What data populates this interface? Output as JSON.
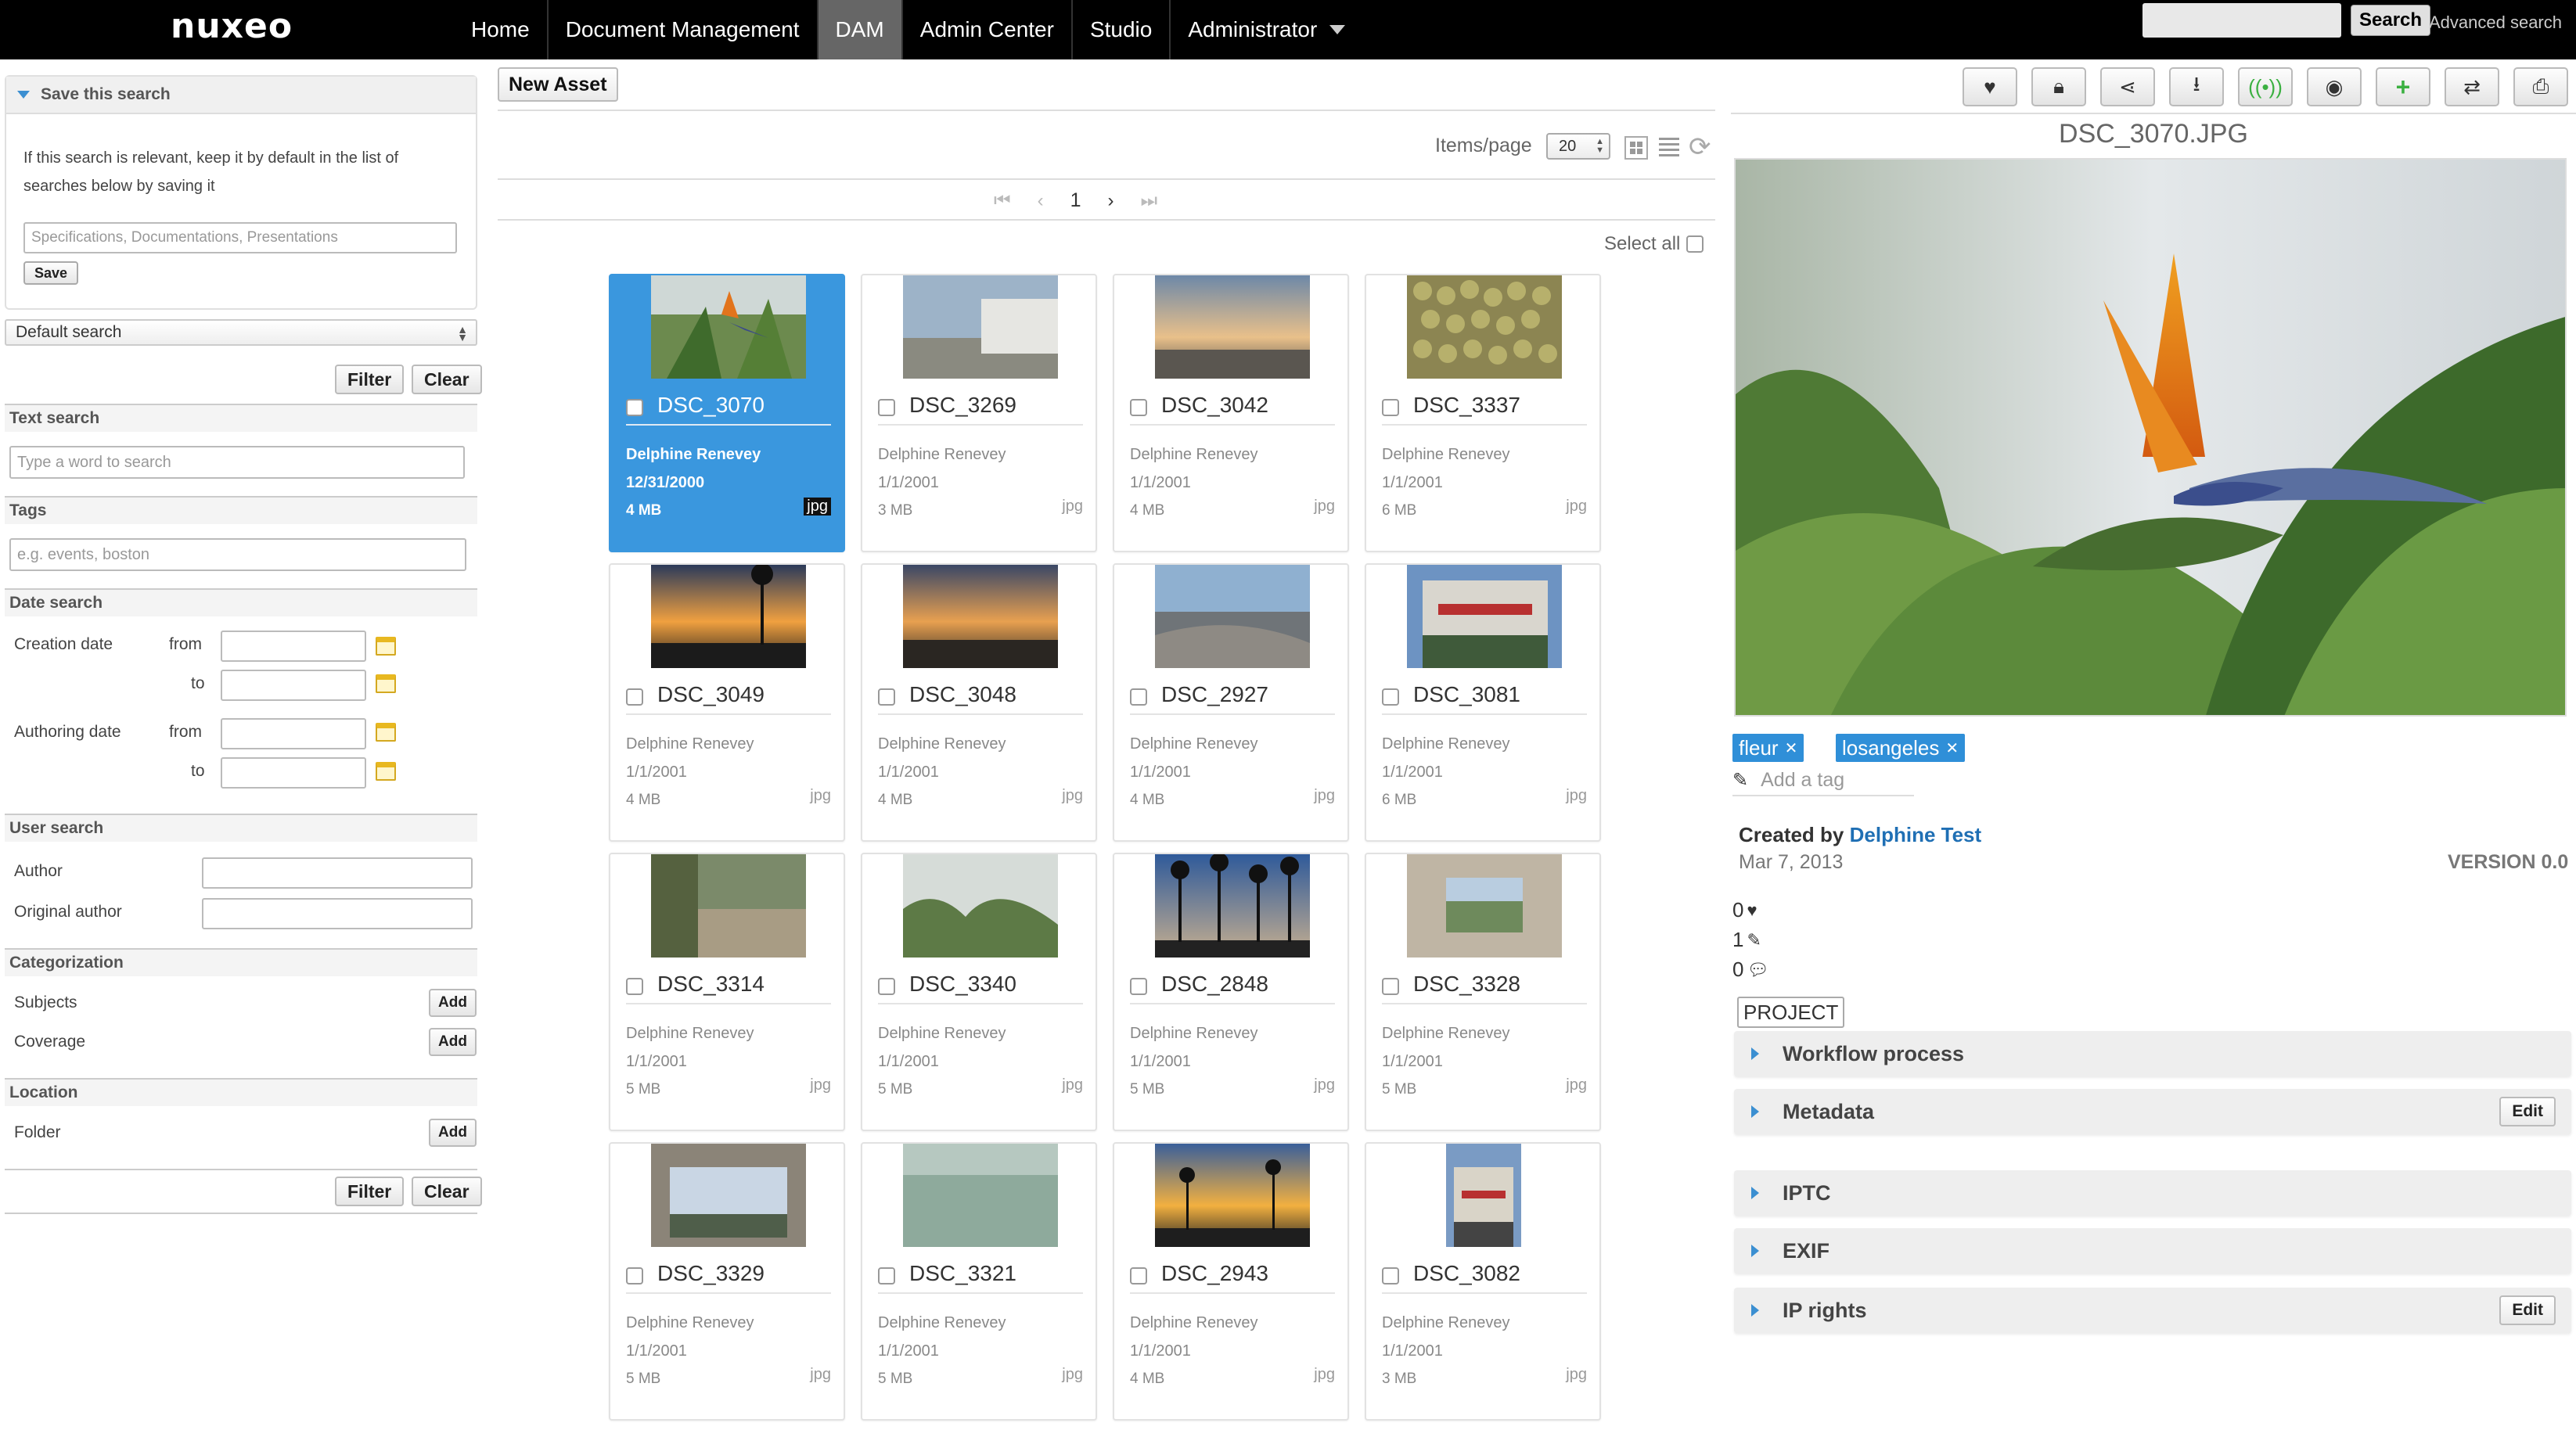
{
  "topbar": {
    "logo": "nuxeo",
    "nav": [
      {
        "label": "Home",
        "active": false
      },
      {
        "label": "Document Management",
        "active": false
      },
      {
        "label": "DAM",
        "active": true
      },
      {
        "label": "Admin Center",
        "active": false
      },
      {
        "label": "Studio",
        "active": false
      },
      {
        "label": "Administrator",
        "active": false
      }
    ],
    "search_button": "Search",
    "advanced_search": "Advanced search"
  },
  "sidebar": {
    "save_search": {
      "header": "Save this search",
      "description": "If this search is relevant, keep it by default in the list of searches below by saving it",
      "placeholder": "Specifications, Documentations, Presentations",
      "save_label": "Save"
    },
    "search_select": "Default search",
    "filter_label": "Filter",
    "clear_label": "Clear",
    "text_search": {
      "header": "Text search",
      "placeholder": "Type a word to search"
    },
    "tags": {
      "header": "Tags",
      "placeholder": "e.g. events, boston"
    },
    "date_search": {
      "header": "Date search",
      "creation_date": "Creation date",
      "authoring_date": "Authoring date",
      "from": "from",
      "to": "to"
    },
    "user_search": {
      "header": "User search",
      "author": "Author",
      "original_author": "Original author"
    },
    "categorization": {
      "header": "Categorization",
      "subjects": "Subjects",
      "coverage": "Coverage",
      "add_label": "Add"
    },
    "location": {
      "header": "Location",
      "folder": "Folder",
      "add_label": "Add"
    }
  },
  "center": {
    "new_asset": "New Asset",
    "items_per_page_label": "Items/page",
    "items_per_page": "20",
    "current_page": "1",
    "select_all": "Select all",
    "assets": [
      {
        "name": "DSC_3070",
        "author": "Delphine Renevey",
        "date": "12/31/2000",
        "size": "4 MB",
        "type": "jpg",
        "selected": true
      },
      {
        "name": "DSC_3269",
        "author": "Delphine Renevey",
        "date": "1/1/2001",
        "size": "3 MB",
        "type": "jpg",
        "selected": false
      },
      {
        "name": "DSC_3042",
        "author": "Delphine Renevey",
        "date": "1/1/2001",
        "size": "4 MB",
        "type": "jpg",
        "selected": false
      },
      {
        "name": "DSC_3337",
        "author": "Delphine Renevey",
        "date": "1/1/2001",
        "size": "6 MB",
        "type": "jpg",
        "selected": false
      },
      {
        "name": "DSC_3049",
        "author": "Delphine Renevey",
        "date": "1/1/2001",
        "size": "4 MB",
        "type": "jpg",
        "selected": false
      },
      {
        "name": "DSC_3048",
        "author": "Delphine Renevey",
        "date": "1/1/2001",
        "size": "4 MB",
        "type": "jpg",
        "selected": false
      },
      {
        "name": "DSC_2927",
        "author": "Delphine Renevey",
        "date": "1/1/2001",
        "size": "4 MB",
        "type": "jpg",
        "selected": false
      },
      {
        "name": "DSC_3081",
        "author": "Delphine Renevey",
        "date": "1/1/2001",
        "size": "6 MB",
        "type": "jpg",
        "selected": false
      },
      {
        "name": "DSC_3314",
        "author": "Delphine Renevey",
        "date": "1/1/2001",
        "size": "5 MB",
        "type": "jpg",
        "selected": false
      },
      {
        "name": "DSC_3340",
        "author": "Delphine Renevey",
        "date": "1/1/2001",
        "size": "5 MB",
        "type": "jpg",
        "selected": false
      },
      {
        "name": "DSC_2848",
        "author": "Delphine Renevey",
        "date": "1/1/2001",
        "size": "5 MB",
        "type": "jpg",
        "selected": false
      },
      {
        "name": "DSC_3328",
        "author": "Delphine Renevey",
        "date": "1/1/2001",
        "size": "5 MB",
        "type": "jpg",
        "selected": false
      },
      {
        "name": "DSC_3329",
        "author": "Delphine Renevey",
        "date": "1/1/2001",
        "size": "5 MB",
        "type": "jpg",
        "selected": false
      },
      {
        "name": "DSC_3321",
        "author": "Delphine Renevey",
        "date": "1/1/2001",
        "size": "5 MB",
        "type": "jpg",
        "selected": false
      },
      {
        "name": "DSC_2943",
        "author": "Delphine Renevey",
        "date": "1/1/2001",
        "size": "4 MB",
        "type": "jpg",
        "selected": false
      },
      {
        "name": "DSC_3082",
        "author": "Delphine Renevey",
        "date": "1/1/2001",
        "size": "3 MB",
        "type": "jpg",
        "selected": false
      }
    ]
  },
  "detail": {
    "toolbar_icons": [
      "heart-icon",
      "lock-icon",
      "share-icon",
      "download-icon",
      "broadcast-icon",
      "eye-icon",
      "plus-icon",
      "swap-icon",
      "print-icon"
    ],
    "title": "DSC_3070.JPG",
    "tags": [
      "fleur",
      "losangeles"
    ],
    "add_tag": "Add a tag",
    "created_by_label": "Created by",
    "created_by": "Delphine Test",
    "created_date": "Mar 7, 2013",
    "version": "VERSION 0.0",
    "likes": "0",
    "edits": "1",
    "comments": "0",
    "project": "PROJECT",
    "sections": [
      {
        "label": "Workflow process",
        "edit": false
      },
      {
        "label": "Metadata",
        "edit": true
      },
      {
        "label": "IPTC",
        "edit": false
      },
      {
        "label": "EXIF",
        "edit": false
      },
      {
        "label": "IP rights",
        "edit": true
      }
    ],
    "edit_label": "Edit"
  },
  "colors": {
    "topbar": "#000000",
    "active_nav": "#666666",
    "selected_card": "#3a97de",
    "tag": "#2f8fd8",
    "link": "#1f6fb4"
  }
}
